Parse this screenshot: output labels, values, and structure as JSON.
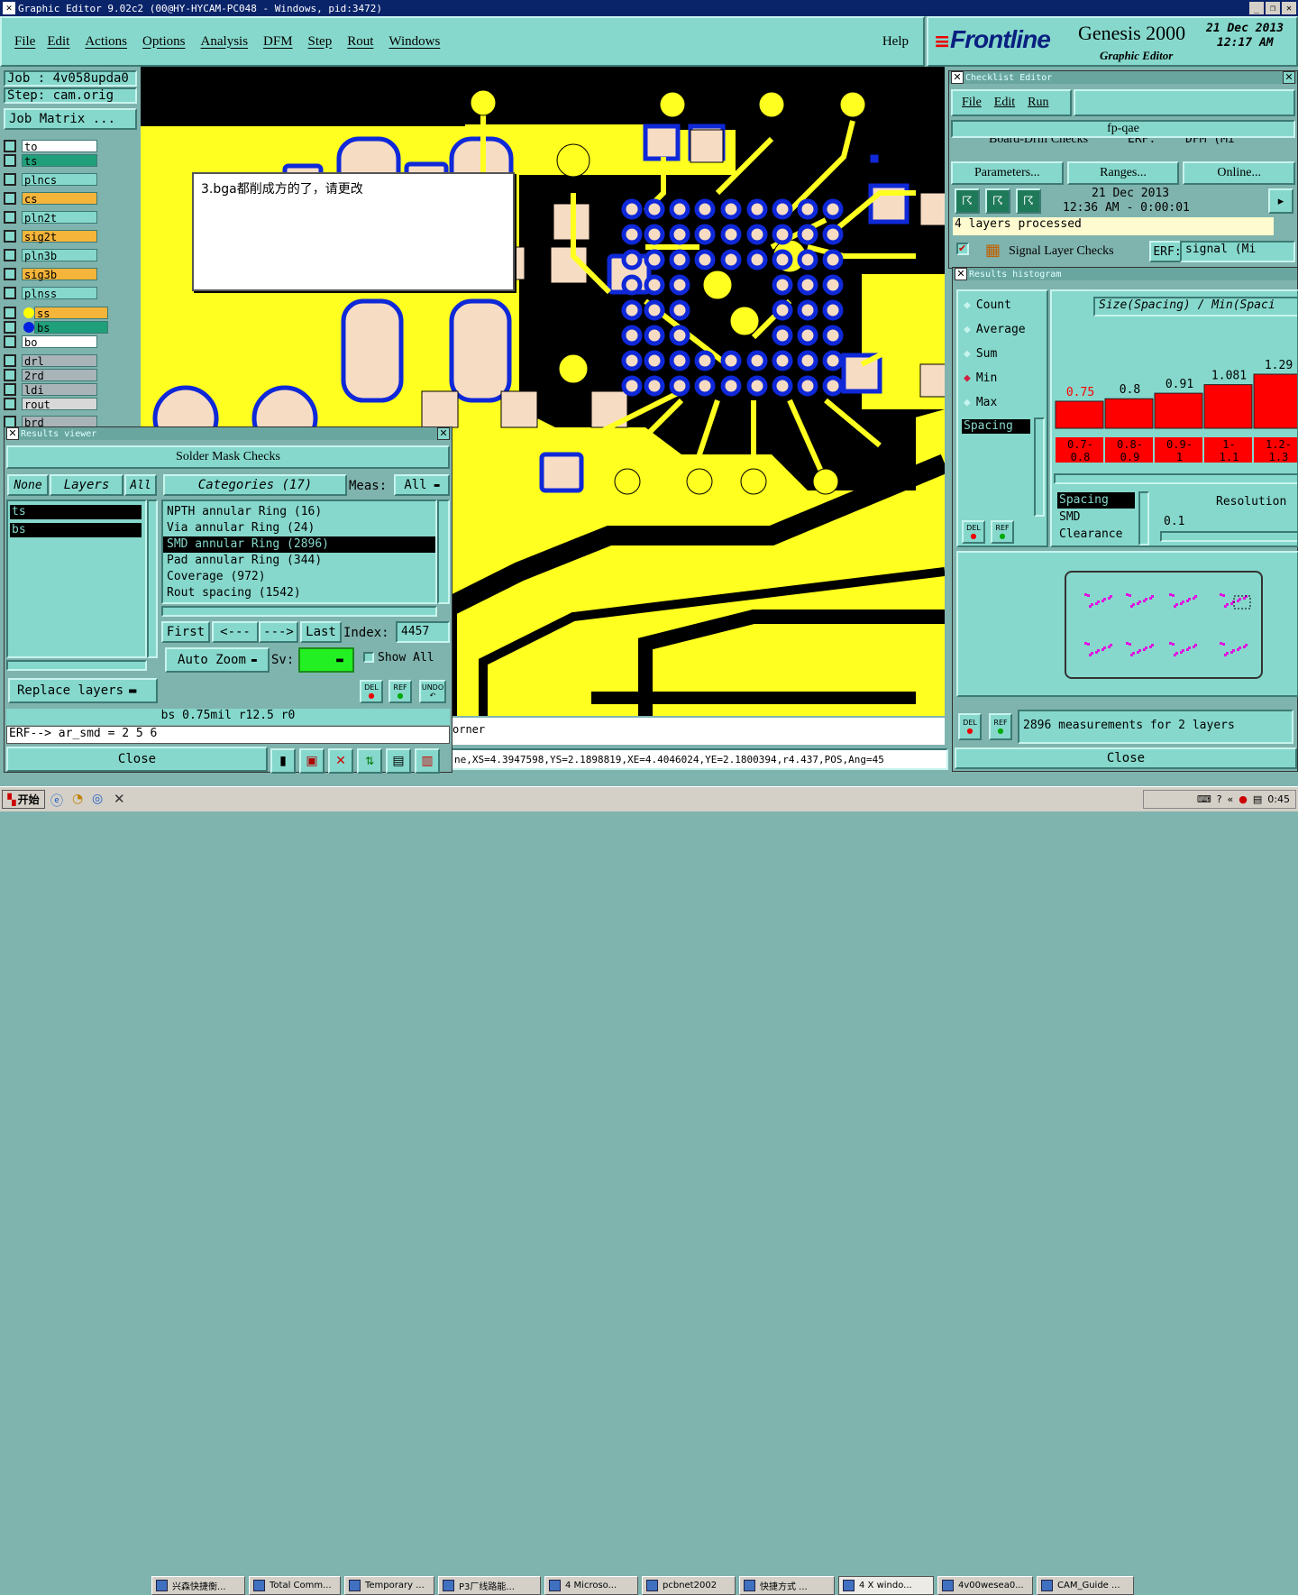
{
  "window": {
    "title": "Graphic Editor 9.02c2 (00@HY-HYCAM-PC048 - Windows, pid:3472)"
  },
  "menu": [
    "File",
    "Edit",
    "Actions",
    "Options",
    "Analysis",
    "DFM",
    "Step",
    "Rout",
    "Windows"
  ],
  "help_label": "Help",
  "brand": {
    "logo": "Frontline",
    "product": "Genesis 2000",
    "subtitle": "Graphic Editor",
    "date": "21 Dec 2013",
    "time": "12:17 AM"
  },
  "job": {
    "job": "Job : 4v058upda0",
    "step": "Step: cam.orig",
    "matrix_button": "Job Matrix ..."
  },
  "layers": [
    {
      "name": "to",
      "color": "#ffffff"
    },
    {
      "name": "ts",
      "color": "#1fa07a"
    },
    {
      "name": "plncs",
      "color": "#86d8cc"
    },
    {
      "name": "cs",
      "color": "#f5b43a"
    },
    {
      "name": "pln2t",
      "color": "#86d8cc"
    },
    {
      "name": "sig2t",
      "color": "#f5b43a"
    },
    {
      "name": "pln3b",
      "color": "#86d8cc"
    },
    {
      "name": "sig3b",
      "color": "#f5b43a"
    },
    {
      "name": "plnss",
      "color": "#86d8cc"
    },
    {
      "name": "ss",
      "color": "#f5b43a"
    },
    {
      "name": "bs",
      "color": "#1fa07a"
    },
    {
      "name": "bo",
      "color": "#ffffff"
    },
    {
      "name": "drl",
      "color": "#a9b4b8"
    },
    {
      "name": "2rd",
      "color": "#a9b4b8"
    },
    {
      "name": "ldi",
      "color": "#a9b4b8"
    },
    {
      "name": "rout",
      "color": "#d8d8d8"
    },
    {
      "name": "brd",
      "color": "#a9b4b8"
    }
  ],
  "note": {
    "text": "3.bga都削成方的了，请更改"
  },
  "status": {
    "corner_text": "orner",
    "coords": "ne,XS=4.3947598,YS=2.1898819,XE=4.4046024,YE=2.1800394,r4.437,POS,Ang=45"
  },
  "results_viewer": {
    "title": "Results viewer",
    "header": "Solder Mask Checks",
    "none_label": "None",
    "layers_label": "Layers",
    "all_label": "All",
    "layers": [
      "ts",
      "bs"
    ],
    "categories_label": "Categories (17)",
    "meas_label": "Meas:",
    "meas_value": "All",
    "categories": [
      "NPTH annular Ring (16)",
      "Via annular Ring (24)",
      "SMD annular Ring (2896)",
      "Pad annular Ring (344)",
      "Coverage (972)",
      "Rout spacing (1542)"
    ],
    "selected_category": 2,
    "nav": {
      "first": "First",
      "prev": "<---",
      "next": "--->",
      "last": "Last",
      "index_label": "Index:",
      "index_value": "4457"
    },
    "auto_zoom": "Auto Zoom",
    "sv_label": "Sv:",
    "show_all": "Show All",
    "replace_layers": "Replace layers",
    "small_buttons": [
      "DEL",
      "REF",
      "UNDO"
    ],
    "info": "bs 0.75mil  r12.5  r0",
    "erf": "ERF--> ar_smd = 2 5 6",
    "close": "Close"
  },
  "checklist": {
    "title": "Checklist Editor",
    "menu": [
      "File",
      "Edit",
      "Run"
    ],
    "name": "fp-qae",
    "item1": {
      "label": "Board-Drill Checks",
      "erf": "ERF:",
      "value": "DFM (Mi"
    },
    "buttons": [
      "Parameters...",
      "Ranges...",
      "Online..."
    ],
    "run_date": "21 Dec 2013",
    "run_time": "12:36 AM - 0:00:01",
    "processed": "4 layers processed",
    "item2": {
      "label": "Signal Layer Checks",
      "erf": "ERF:",
      "value": "signal (Mi"
    }
  },
  "histogram": {
    "title": "Results histogram",
    "modes": [
      "Count",
      "Average",
      "Sum",
      "Min",
      "Max"
    ],
    "selected_mode": "Min",
    "header": "Size(Spacing) / Min(Spaci",
    "list1": [
      "Spacing"
    ],
    "list2": [
      "Spacing",
      "SMD",
      "Clearance"
    ],
    "resolution_label": "Resolution",
    "resolution_value": "0.1",
    "summary": "2896 measurements for 2 layers",
    "close": "Close",
    "small_buttons": [
      "DEL",
      "REF"
    ]
  },
  "chart_data": {
    "type": "bar",
    "categories": [
      "0.7-0.8",
      "0.8-0.9",
      "0.9-1",
      "1-1.1",
      "1.2-1.3"
    ],
    "values": [
      0.75,
      0.8,
      0.91,
      1.081,
      1.29
    ],
    "title": "Size(Spacing) / Min(Spaci",
    "colors": {
      "bar": "#ff0000",
      "first_label": "#ff0000"
    }
  },
  "taskbar": {
    "start": "开始",
    "tasks": [
      "兴森快捷衡...",
      "Total Comm...",
      "Temporary ...",
      "P3厂线路能...",
      "4 Microso...",
      "pcbnet2002",
      "快捷方式 ...",
      "4 X windo...",
      "4v00wesea0...",
      "CAM_Guide ..."
    ],
    "clock": "0:45"
  },
  "colors": {
    "board": "#ffff20",
    "pad": "#f7dcc4",
    "outline": "#0f28d8",
    "background": "#000000",
    "panel": "#86d8cc"
  }
}
